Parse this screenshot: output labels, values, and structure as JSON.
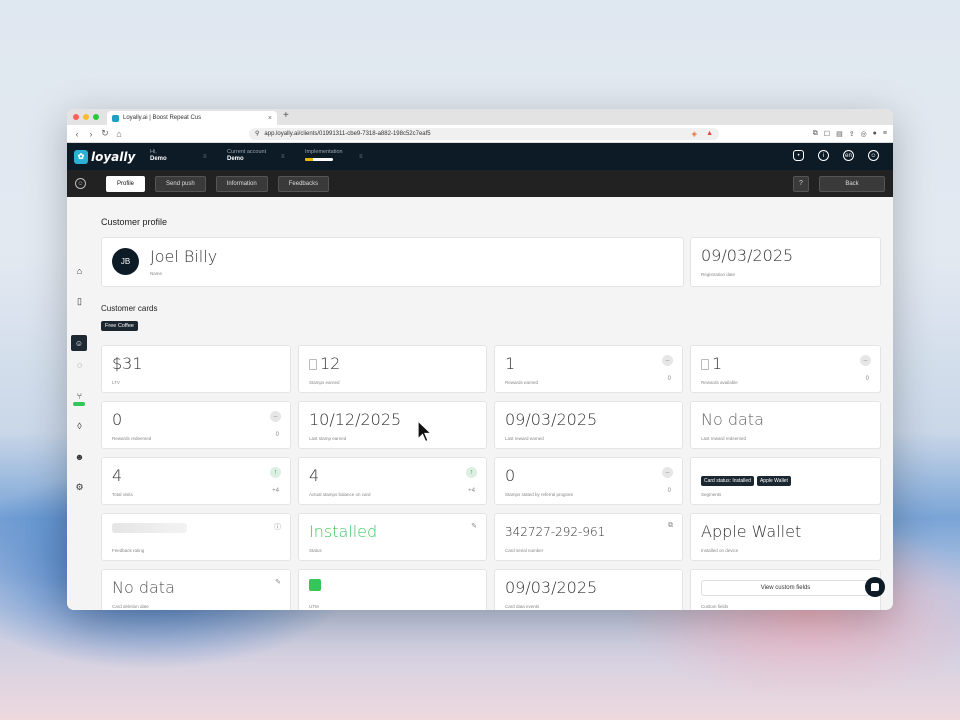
{
  "browser": {
    "tab_title": "Loyally.ai | Boost Repeat Cus",
    "url": "app.loyally.ai/clients/01991311-cbe9-7318-a882-198c52c7eaf5"
  },
  "header": {
    "logo_text": "loyally",
    "greeting_label": "Hi,",
    "greeting_name": "Demo",
    "account_label": "Current account",
    "account_name": "Demo",
    "implementation_label": "Implementation",
    "implementation_progress": 0.3
  },
  "subnav": {
    "tabs": [
      "Profile",
      "Send push",
      "Information",
      "Feedbacks"
    ],
    "active_tab": "Profile",
    "help_label": "?",
    "back_label": "Back"
  },
  "profile": {
    "section_title": "Customer profile",
    "initials": "JB",
    "name": "Joel Billy",
    "name_label": "Name",
    "registration_date": "09/03/2025",
    "registration_label": "Registration date"
  },
  "cards_section": {
    "title": "Customer cards",
    "chip": "Free Coffee"
  },
  "cards": {
    "ltv": {
      "value": "$31",
      "label": "LTV"
    },
    "stamps_earned": {
      "value": "12",
      "label": "Stamps earned"
    },
    "rewards_earned": {
      "value": "1",
      "label": "Rewards earned",
      "count": "0"
    },
    "rewards_available": {
      "value": "1",
      "label": "Rewards available",
      "count": "0"
    },
    "rewards_redeemed": {
      "value": "0",
      "label": "Rewards redeemed",
      "count": "0"
    },
    "last_stamp_earned": {
      "value": "10/12/2025",
      "label": "Last stamp earned"
    },
    "last_reward_earned": {
      "value": "09/03/2025",
      "label": "Last reward earned"
    },
    "last_reward_redeemed": {
      "value": "No data",
      "label": "Last reward redeemed"
    },
    "total_visits": {
      "value": "4",
      "label": "Total visits",
      "count": "+4"
    },
    "actual_stamps": {
      "value": "4",
      "label": "Actual stamps balance on card",
      "count": "+4"
    },
    "stamps_referral": {
      "value": "0",
      "label": "Stamps stated by referral program",
      "count": "0"
    },
    "segments": {
      "label": "Segments",
      "tags": [
        "Card status: Installed",
        "Apple Wallet"
      ]
    },
    "feedback_rating": {
      "label": "Feedback rating"
    },
    "status": {
      "value": "Installed",
      "label": "Status"
    },
    "card_number": {
      "value": "342727-292-961",
      "label": "Card serial number"
    },
    "installed_device": {
      "value": "Apple Wallet",
      "label": "Installed on device"
    },
    "card_deletion": {
      "value": "No data",
      "label": "Card deletion date"
    },
    "utm": {
      "label": "UTM"
    },
    "card_created": {
      "value": "09/03/2025",
      "label": "Card data events"
    },
    "custom_fields": {
      "button": "View custom fields",
      "label": "Custom fields"
    }
  }
}
